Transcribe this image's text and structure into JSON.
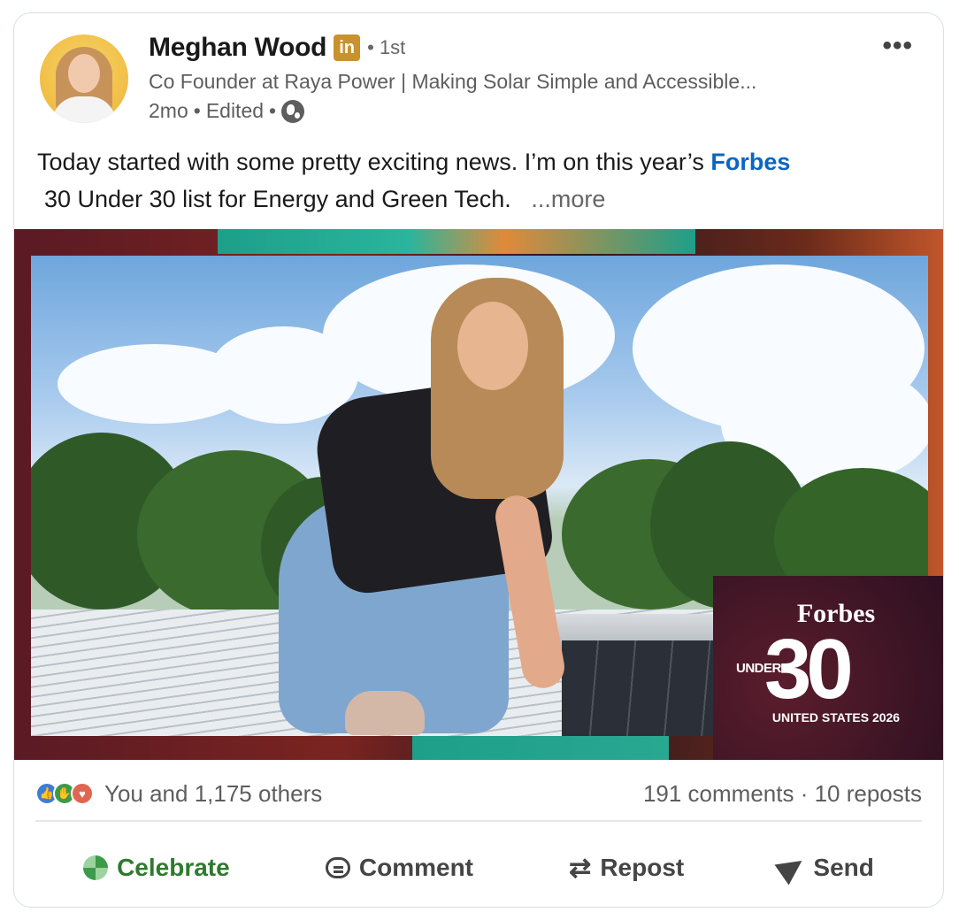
{
  "author": {
    "name": "Meghan Wood",
    "badge": "in",
    "connection": "• 1st",
    "headline": "Co Founder at Raya Power | Making Solar Simple and Accessible...",
    "time": "2mo",
    "sep1": "•",
    "edited": "Edited",
    "sep2": "•",
    "visibility_icon": "globe-icon"
  },
  "menu_icon": "•••",
  "post": {
    "text_before": "Today started with some pretty exciting news. I’m on this year’s ",
    "link": "Forbes",
    "line2": "30 Under 30 list for Energy and Green Tech.",
    "more": "...more"
  },
  "image_badge": {
    "brand": "Forbes",
    "under": "UNDER",
    "number": "30",
    "subtitle": "UNITED STATES 2026"
  },
  "social": {
    "reactions_text": "You and 1,175 others",
    "comments_reposts": "191 comments · 10 reposts",
    "reaction_icons": [
      "like-icon",
      "celebrate-icon",
      "love-icon"
    ]
  },
  "actions": [
    {
      "label": "Celebrate",
      "icon": "celebrate-icon",
      "color": "#2f7a2e"
    },
    {
      "label": "Comment",
      "icon": "comment-icon"
    },
    {
      "label": "Repost",
      "icon": "repost-icon"
    },
    {
      "label": "Send",
      "icon": "send-icon"
    }
  ],
  "colors": {
    "link": "#0a66c2",
    "linkedin_badge": "#c8922e",
    "muted_text": "#5e5e5e"
  }
}
